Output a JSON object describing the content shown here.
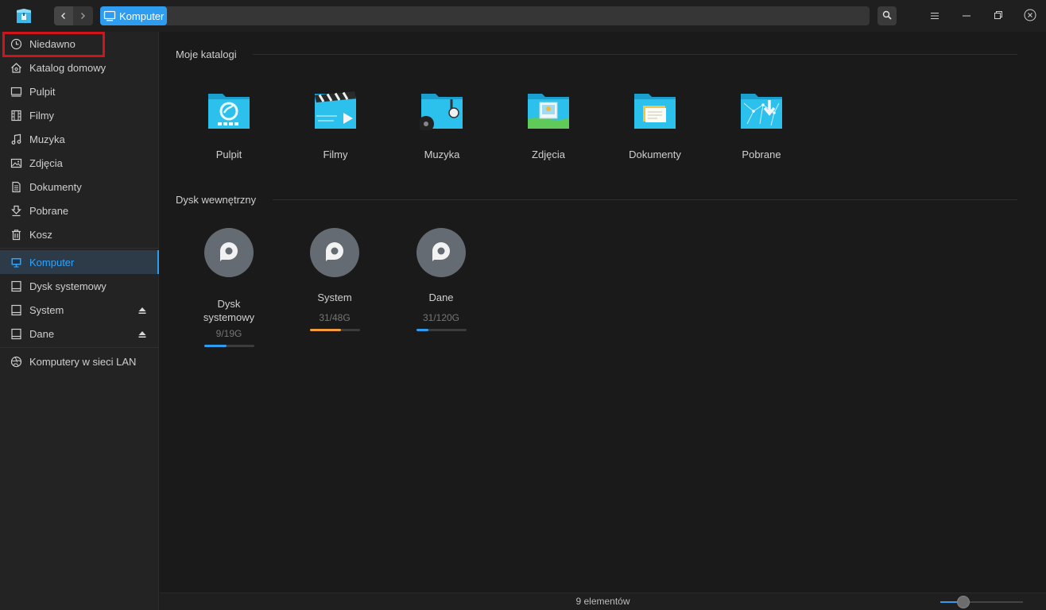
{
  "colors": {
    "accent": "#2e9cef",
    "bar_orange": "#f39c3c",
    "highlight_box": "#d0151a"
  },
  "toolbar": {
    "breadcrumb": "Komputer",
    "icons": [
      "app-logo-icon",
      "chevron-left-icon",
      "chevron-right-icon",
      "computer-icon",
      "search-icon",
      "menu-icon",
      "minimize-icon",
      "restore-icon",
      "close-icon"
    ]
  },
  "sidebar": {
    "items": [
      {
        "label": "Niedawno",
        "icon": "clock-icon"
      },
      {
        "label": "Katalog domowy",
        "icon": "home-icon"
      },
      {
        "label": "Pulpit",
        "icon": "desktop-icon"
      },
      {
        "label": "Filmy",
        "icon": "film-icon"
      },
      {
        "label": "Muzyka",
        "icon": "music-icon"
      },
      {
        "label": "Zdjęcia",
        "icon": "image-icon"
      },
      {
        "label": "Dokumenty",
        "icon": "document-icon"
      },
      {
        "label": "Pobrane",
        "icon": "download-icon"
      },
      {
        "label": "Kosz",
        "icon": "trash-icon"
      },
      {
        "label": "Komputer",
        "icon": "computer-icon",
        "active": true
      },
      {
        "label": "Dysk systemowy",
        "icon": "drive-icon"
      },
      {
        "label": "System",
        "icon": "drive-icon",
        "eject": true
      },
      {
        "label": "Dane",
        "icon": "drive-icon",
        "eject": true
      },
      {
        "label": "Komputery w sieci LAN",
        "icon": "network-icon"
      }
    ]
  },
  "main": {
    "folders_title": "Moje katalogi",
    "folders": [
      {
        "label": "Pulpit",
        "icon": "desktop-folder-icon"
      },
      {
        "label": "Filmy",
        "icon": "videos-folder-icon"
      },
      {
        "label": "Muzyka",
        "icon": "music-folder-icon"
      },
      {
        "label": "Zdjęcia",
        "icon": "pictures-folder-icon"
      },
      {
        "label": "Dokumenty",
        "icon": "documents-folder-icon"
      },
      {
        "label": "Pobrane",
        "icon": "downloads-folder-icon"
      }
    ],
    "drives_title": "Dysk wewnętrzny",
    "drives": [
      {
        "name_line1": "Dysk",
        "name_line2": "systemowy",
        "size": "9/19G",
        "usage": 0.45,
        "color": "#2e9cef"
      },
      {
        "name_line1": "System",
        "name_line2": "",
        "size": "31/48G",
        "usage": 0.63,
        "color": "#f39c3c"
      },
      {
        "name_line1": "Dane",
        "name_line2": "",
        "size": "31/120G",
        "usage": 0.25,
        "color": "#2e9cef"
      }
    ]
  },
  "status": {
    "count_text": "9 elementów",
    "zoom": 0.28
  }
}
